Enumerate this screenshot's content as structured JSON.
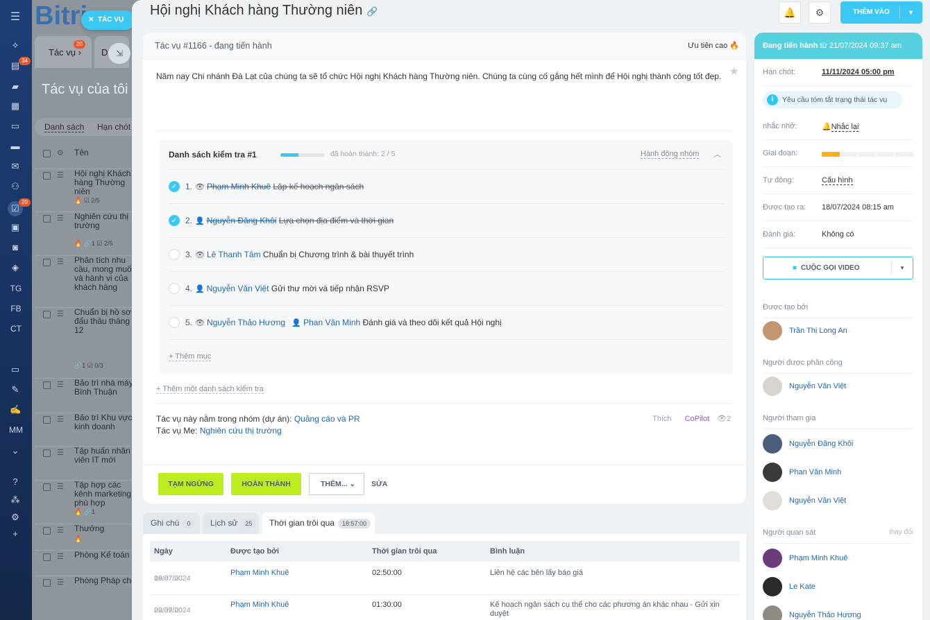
{
  "sidebar": {
    "badges": {
      "chat": "34",
      "tasks": "20"
    },
    "labels": [
      "TG",
      "FB",
      "CT",
      "MM"
    ]
  },
  "background": {
    "logo": "Bitri",
    "task_pill": "TÁC VỤ",
    "tab_tasks": "Tác vụ",
    "tab_tasks_badge": "20",
    "tab_d": "D",
    "title": "Tác vụ của tôi",
    "filter_list": "Danh sách",
    "filter_deadline": "Hạn chót",
    "col_name": "Tên",
    "rows": [
      {
        "text": "Hội nghị Khách hàng Thường niên",
        "meta": "🔥 ☑ 2/5"
      },
      {
        "text": "Nghiên cứu thị trường",
        "meta": "🔥 🔗1 ☑ 2/5"
      },
      {
        "text": "Phân tích nhu cầu, mong muốn và hành vi của khách hàng",
        "meta": ""
      },
      {
        "text": "Chuẩn bị hồ sơ đấu thầu tháng 12",
        "meta": "🔗1 ☑ 0/3"
      },
      {
        "text": "Bảo trì nhà máy Bình Thuận",
        "meta": ""
      },
      {
        "text": "Bảo trì Khu vực kinh doanh",
        "meta": ""
      },
      {
        "text": "Tập huấn nhân viên IT mới",
        "meta": ""
      },
      {
        "text": "Tập hợp các kênh marketing phù hợp",
        "meta": "🔥 🔗1"
      },
      {
        "text": "Thưởng",
        "meta": "🔥"
      },
      {
        "text": "Phòng Kế toán",
        "meta": ""
      },
      {
        "text": "Phòng Pháp chế",
        "meta": ""
      }
    ]
  },
  "header": {
    "title": "Hội nghị Khách hàng Thường niên",
    "add_button": "THÊM VÀO"
  },
  "task": {
    "status": "Tác vụ #1166 - đang tiến hành",
    "priority": "Ưu tiên cao",
    "description": "Năm nay Chi nhánh Đà Lạt của chúng ta sẽ tổ chức Hội nghị Khách hàng Thường niên. Chúng ta cùng cố gắng hết mình để Hội nghị thành công tốt đẹp."
  },
  "checklist": {
    "title": "Danh sách kiểm tra #1",
    "progress": 0.4,
    "done_text": "đã hoàn thành: 2 / 5",
    "group_action": "Hành động nhóm",
    "items": [
      {
        "num": "1.",
        "person": "Phạm Minh Khuê",
        "text": "Lập kế hoạch ngân sách",
        "done": true
      },
      {
        "num": "2.",
        "person": "Nguyễn Đăng Khôi",
        "text": "Lựa chọn địa điểm và thời gian",
        "done": true
      },
      {
        "num": "3.",
        "person": "Lê Thanh Tâm",
        "text": "Chuẩn bị Chương trình & bài thuyết trình",
        "done": false
      },
      {
        "num": "4.",
        "person": "Nguyễn Văn Việt",
        "text": "Gửi thư mời và tiếp nhận RSVP",
        "done": false
      },
      {
        "num": "5.",
        "person": "Nguyễn Thảo Hương",
        "person2": "Phan Văn Minh",
        "text": "Đánh giá và theo dõi kết quả Hội nghị",
        "done": false
      }
    ],
    "add_item": "+ Thêm mục",
    "add_checklist": "+ Thêm một danh sách kiểm tra"
  },
  "meta": {
    "group_label": "Tác vụ này nằm trong nhóm (dự án):",
    "group": "Quảng cáo và PR",
    "parent_label": "Tác vụ Mẹ:",
    "parent": "Nghiên cứu thị trường",
    "like": "Thích",
    "copilot": "CoPilot",
    "views": "2"
  },
  "actions": {
    "pause": "TẠM NGỪNG",
    "complete": "HOÀN THÀNH",
    "more": "THÊM...",
    "edit": "SỬA"
  },
  "tabs": [
    {
      "label": "Ghi chú",
      "count": "0"
    },
    {
      "label": "Lịch sử",
      "count": "25"
    },
    {
      "label": "Thời gian trôi qua",
      "count": "18:57:00"
    }
  ],
  "time_table": {
    "headers": [
      "Ngày",
      "Được tạo bởi",
      "Thời gian trôi qua",
      "Bình luận"
    ],
    "rows": [
      {
        "date": "19/07/2024",
        "time": "08:37:00",
        "by": "Phạm Minh Khuê",
        "spent": "02:50:00",
        "comment": "Liên hệ các bên lấy báo giá"
      },
      {
        "date": "22/07/2024",
        "time": "09:39:00",
        "by": "Phạm Minh Khuê",
        "spent": "01:30:00",
        "comment": "Kế hoạch ngân sách cụ thể cho các phương án khác nhau - Gửi xin duyệt"
      }
    ]
  },
  "right": {
    "status_bold": "Đang tiến hành",
    "status_rest": " từ 21/07/2024 09:37 am",
    "deadline_label": "Hạn chót:",
    "deadline": "11/11/2024 05:00 pm",
    "ai_text": "Yêu cầu tóm tắt trạng thái tác vụ",
    "reminder_label": "nhắc nhở:",
    "reminder": "Nhắc lại",
    "stage_label": "Giai đoạn:",
    "stage_progress": 0.2,
    "auto_label": "Tự động:",
    "auto": "Cấu hình",
    "created_label": "Được tạo ra:",
    "created": "18/07/2024 08:15 am",
    "rating_label": "Đánh giá:",
    "rating": "Không có",
    "video": "CUỘC GỌI VIDEO",
    "creator_title": "Được tạo bởi",
    "creator": "Trần Thị Long An",
    "assignee_title": "Người được phân công",
    "assignee": "Nguyễn Văn Việt",
    "participants_title": "Người tham gia",
    "participants": [
      "Nguyễn Đăng Khôi",
      "Phan Văn Minh",
      "Nguyễn Văn Việt"
    ],
    "observers_title": "Người quan sát",
    "change": "thay đổi",
    "observers": [
      "Phạm Minh Khuê",
      "Le Kate",
      "Nguyễn Thảo Hương"
    ]
  }
}
